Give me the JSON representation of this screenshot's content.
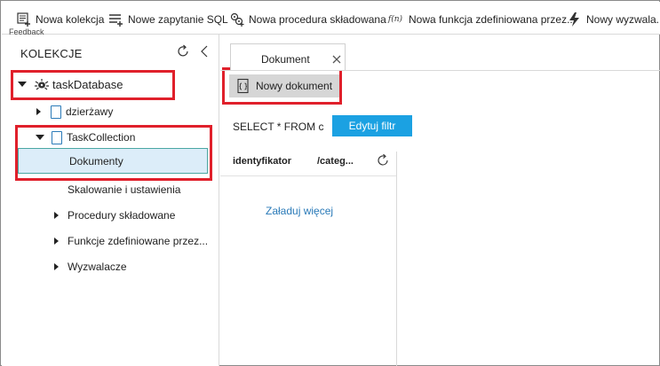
{
  "toolbar": {
    "new_collection": "Nowa kolekcja",
    "new_sql_query": "Nowe zapytanie SQL",
    "new_stored_procedure": "Nowa procedura składowana",
    "new_udf": "Nowa funkcja zdefiniowana przez...",
    "new_trigger": "Nowy wyzwala...",
    "feedback": "Feedback",
    "icons": {
      "new_collection": "new-collection-icon",
      "new_sql_query": "sql-query-icon",
      "new_stored_procedure": "stored-procedure-icon",
      "new_udf": "fn-icon",
      "new_udf_glyph": "f(n)",
      "new_trigger": "lightning-icon"
    }
  },
  "sidebar": {
    "title": "KOLEKCJE",
    "database": "taskDatabase",
    "items": [
      {
        "label": "dzierżawy"
      },
      {
        "label": "TaskCollection"
      },
      {
        "label": "Dokumenty"
      },
      {
        "label": "Skalowanie i ustawienia"
      },
      {
        "label": "Procedury składowane"
      },
      {
        "label": "Funkcje zdefiniowane przez..."
      },
      {
        "label": "Wyzwalacze"
      }
    ]
  },
  "main": {
    "tab_label": "Dokument",
    "new_document": "Nowy dokument",
    "query": "SELECT * FROM c",
    "edit_filter": "Edytuj filtr",
    "columns": [
      "identyfikator",
      "/categ..."
    ],
    "load_more": "Załaduj więcej"
  },
  "colors": {
    "accent": "#1ba1e2",
    "highlight_border": "#e0202b",
    "selected_row_bg": "#dcedf9",
    "selected_row_border": "#4aa7a3",
    "link": "#2a7ab8"
  }
}
